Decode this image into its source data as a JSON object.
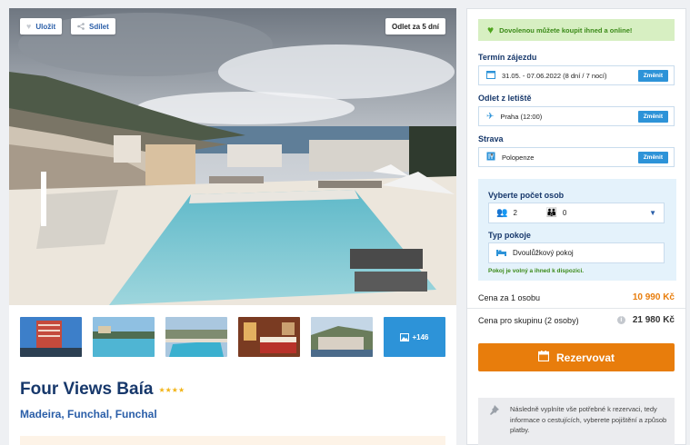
{
  "hero": {
    "save_label": "Uložit",
    "share_label": "Sdílet",
    "departure_badge": "Odlet za 5 dní"
  },
  "gallery": {
    "more_count": "+146"
  },
  "hotel": {
    "name": "Four Views Baía",
    "stars": "★★★★",
    "location": "Madeira, Funchal, Funchal"
  },
  "booking": {
    "notice": "Dovolenou můžete koupit ihned a online!",
    "term_label": "Termín zájezdu",
    "term_value": "31.05. - 07.06.2022 (8 dní / 7 nocí)",
    "airport_label": "Odlet z letiště",
    "airport_value": "Praha (12:00)",
    "board_label": "Strava",
    "board_value": "Polopenze",
    "change_label": "Změnit",
    "persons_label": "Vyberte počet osob",
    "adults": "2",
    "children": "0",
    "room_label": "Typ pokoje",
    "room_value": "Dvoulůžkový pokoj",
    "room_note": "Pokoj je volný a ihned k dispozici.",
    "price_person_label": "Cena za 1 osobu",
    "price_person_value": "10 990 Kč",
    "price_group_label": "Cena pro skupinu (2 osoby)",
    "price_group_value": "21 980 Kč",
    "reserve_label": "Rezervovat",
    "info_text": "Následně vyplníte vše potřebné k rezervaci, tedy informace o cestujících, vyberete pojištění a způsob platby."
  },
  "colors": {
    "brand_blue": "#17386b",
    "link_blue": "#2a5ea8",
    "action_blue": "#2d93d8",
    "accent_orange": "#e87d0c",
    "success_green": "#3b8a18"
  }
}
